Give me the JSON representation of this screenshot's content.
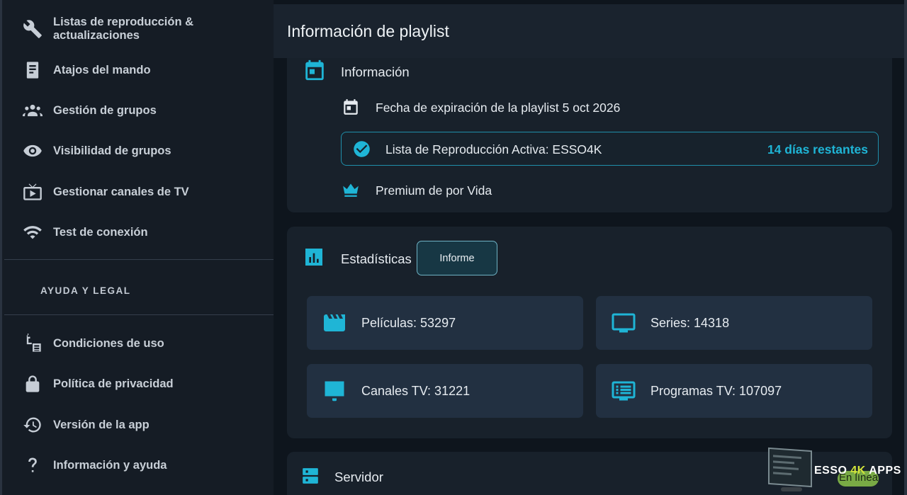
{
  "sidebar": {
    "items": [
      {
        "label": "Listas de reproducción & actualizaciones",
        "icon": "wrench-icon"
      },
      {
        "label": "Atajos del mando",
        "icon": "remote-icon"
      },
      {
        "label": "Gestión de grupos",
        "icon": "groups-icon"
      },
      {
        "label": "Visibilidad de grupos",
        "icon": "eye-icon"
      },
      {
        "label": "Gestionar canales de TV",
        "icon": "live-tv-icon"
      },
      {
        "label": "Test de conexión",
        "icon": "wifi-icon"
      }
    ],
    "section_title": "AYUDA Y LEGAL",
    "help_items": [
      {
        "label": "Condiciones de uso",
        "icon": "terms-icon"
      },
      {
        "label": "Política de privacidad",
        "icon": "lock-icon"
      },
      {
        "label": "Versión de la app",
        "icon": "history-icon"
      },
      {
        "label": "Información y ayuda",
        "icon": "question-icon"
      }
    ]
  },
  "main": {
    "title": "Información de playlist",
    "info": {
      "heading": "Información",
      "expiry": "Fecha de expiración de la playlist 5 oct 2026",
      "active_playlist": "Lista de Reproducción Activa: ESSO4K",
      "days_left": "14 días restantes",
      "premium": "Premium de por Vida"
    },
    "stats": {
      "heading": "Estadísticas",
      "report_button": "Informe",
      "items": [
        {
          "label": "Películas: 53297",
          "icon": "movie-icon"
        },
        {
          "label": "Series: 14318",
          "icon": "tv-icon"
        },
        {
          "label": "Canales TV: 31221",
          "icon": "live-channels-icon"
        },
        {
          "label": "Programas TV: 107097",
          "icon": "tv-guide-icon"
        }
      ]
    },
    "server": {
      "heading": "Servidor"
    }
  },
  "watermark": {
    "brand_prefix": "ESSO ",
    "brand_highlight": "4K",
    "brand_suffix": " APPS",
    "badge": "En línea"
  },
  "colors": {
    "accent": "#1fb5d6",
    "sidebar_bg": "#151c25",
    "card_bg": "#18212b",
    "stat_bg": "#223041"
  }
}
